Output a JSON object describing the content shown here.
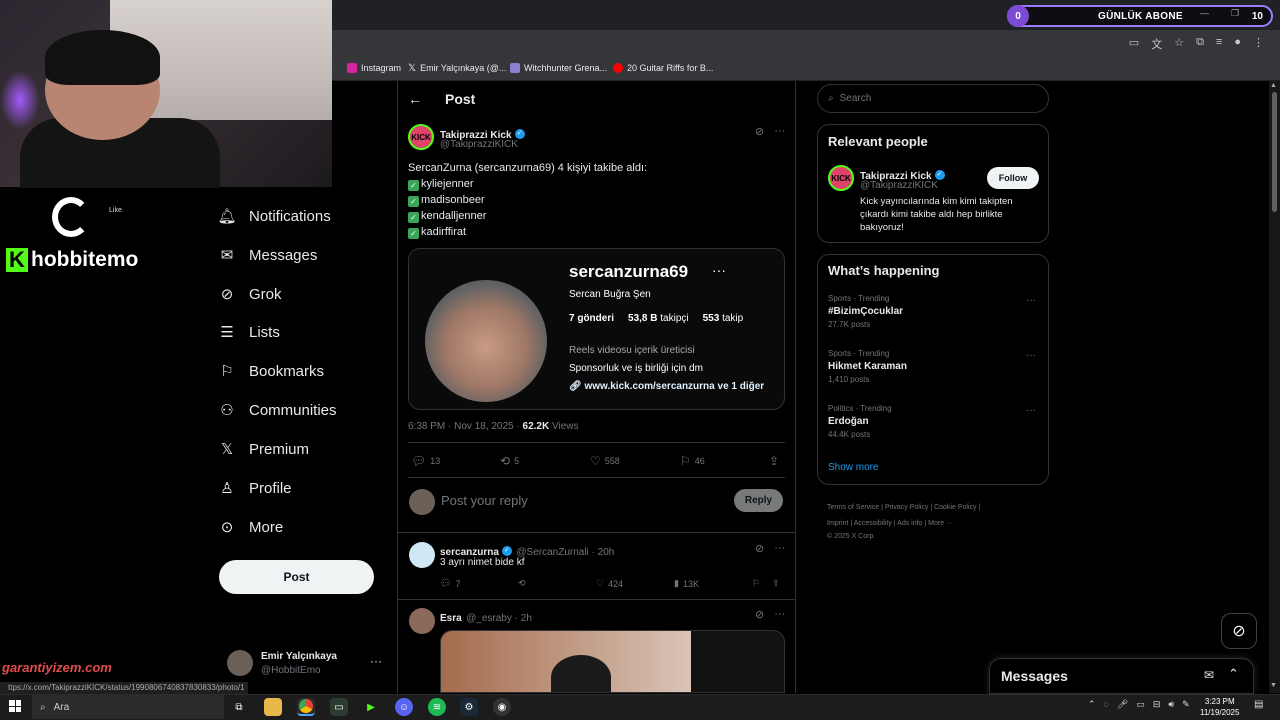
{
  "overlay": {
    "abone_count_left": "0",
    "abone_title": "GÜNLÜK ABONE",
    "abone_count_right": "10",
    "logo_like": "Like",
    "streamer_handle": "hobbitemo",
    "kick_letter": "K",
    "watermark": "garantiyizem.com"
  },
  "browser": {
    "bookmarks": [
      {
        "label": "Instagram",
        "icon": "instagram-icon",
        "color": "#d6249f"
      },
      {
        "label": "Emir Yalçınkaya (@...",
        "icon": "x-icon",
        "color": "#000000"
      },
      {
        "label": "Witchhunter Grena...",
        "icon": "shield-icon",
        "color": "#8a7fd0"
      },
      {
        "label": "20 Guitar Riffs for B...",
        "icon": "youtube-icon",
        "color": "#ff0000"
      }
    ],
    "status_url": "ttps://x.com/TakiprazziKICK/status/1990806740837830833/photo/1"
  },
  "nav": {
    "items": [
      {
        "label": "Notifications",
        "icon": "bell-icon"
      },
      {
        "label": "Messages",
        "icon": "envelope-icon"
      },
      {
        "label": "Grok",
        "icon": "grok-icon"
      },
      {
        "label": "Lists",
        "icon": "list-icon"
      },
      {
        "label": "Bookmarks",
        "icon": "bookmark-icon"
      },
      {
        "label": "Communities",
        "icon": "people-icon"
      },
      {
        "label": "Premium",
        "icon": "x-logo-icon"
      },
      {
        "label": "Profile",
        "icon": "person-icon"
      },
      {
        "label": "More",
        "icon": "more-circle-icon"
      }
    ],
    "post_button": "Post",
    "account_name": "Emir Yalçınkaya",
    "account_handle": "@HobbitEmo"
  },
  "post": {
    "header_title": "Post",
    "author_name": "Takiprazzi Kick",
    "author_handle": "@TakiprazziKICK",
    "avatar_text": "KICK",
    "text_line1": "SercanZurna (sercanzurna69) 4 kişiyi takibe aldı:",
    "followed": [
      "kyliejenner",
      "madisonbeer",
      "kendalljenner",
      "kadirffirat"
    ],
    "media": {
      "username": "sercanzurna69",
      "dots": "···",
      "full_name": "Sercan Buğra Şen",
      "posts": "7 gönderi",
      "followers_num": "53,8 B",
      "followers_label": "takipçi",
      "following_num": "553",
      "following_label": "takip",
      "category": "Reels videosu içerik üreticisi",
      "bio": "Sponsorluk ve iş birliği için dm",
      "link": "www.kick.com/sercanzurna ve 1 diğer"
    },
    "time": "6:38 PM · Nov 18, 2025 · ",
    "views_num": "62.2K",
    "views_label": " Views",
    "replies": "13",
    "reposts": "5",
    "likes": "558",
    "bookmarks": "46",
    "reply_placeholder": "Post your reply",
    "reply_button": "Reply"
  },
  "replies": [
    {
      "name": "sercanzurna",
      "handle": "@SercanZurnali · 20h",
      "text": "3 ayrı nimet bide kf",
      "replies": "7",
      "reposts": "",
      "likes": "424",
      "views": "13K"
    },
    {
      "name": "Esra",
      "handle": "@_esraby · 2h"
    }
  ],
  "sidebar": {
    "search_placeholder": "Search",
    "relevant_title": "Relevant people",
    "person_name": "Takiprazzi Kick",
    "person_handle": "@TakiprazziKICK",
    "person_bio": "Kick yayıncılarında kim kimi takipten çıkardı kimi takibe aldı hep birlikte bakıyoruz!",
    "follow_button": "Follow",
    "happening_title": "What’s happening",
    "trends": [
      {
        "meta": "Sports · Trending",
        "name": "#BizimÇocuklar",
        "count": "27.7K posts"
      },
      {
        "meta": "Sports · Trending",
        "name": "Hikmet Karaman",
        "count": "1,410 posts"
      },
      {
        "meta": "Politics · Trending",
        "name": "Erdoğan",
        "count": "44.4K posts"
      }
    ],
    "show_more": "Show more",
    "footer_line1": "Terms of Service  |  Privacy Policy  |  Cookie Policy  |",
    "footer_line2": "Imprint  |  Accessibility  |  Ads info  |  More ···",
    "footer_line3": "© 2025 X Corp.",
    "messages_title": "Messages"
  },
  "taskbar": {
    "search": "Ara",
    "time": "3:23 PM",
    "date": "11/19/2025"
  }
}
